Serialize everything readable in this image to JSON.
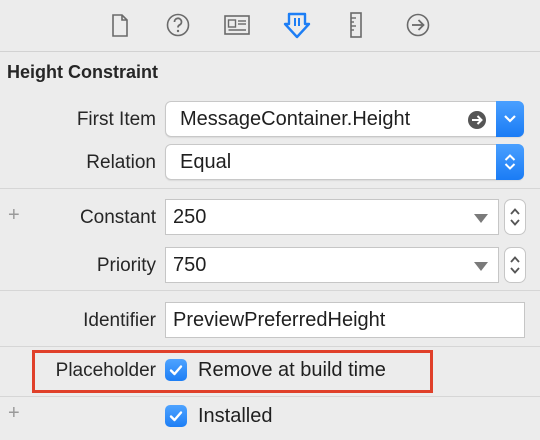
{
  "toolbar": {
    "icons": [
      "file-icon",
      "help-icon",
      "identity-icon",
      "attributes-icon",
      "size-icon",
      "connections-icon"
    ]
  },
  "section": {
    "title": "Height Constraint"
  },
  "first_item": {
    "label": "First Item",
    "value": "MessageContainer.Height"
  },
  "relation": {
    "label": "Relation",
    "value": "Equal"
  },
  "constant": {
    "label": "Constant",
    "value": "250"
  },
  "priority": {
    "label": "Priority",
    "value": "750"
  },
  "identifier": {
    "label": "Identifier",
    "value": "PreviewPreferredHeight"
  },
  "placeholder": {
    "label": "Placeholder",
    "checkbox_label": "Remove at build time",
    "checked": true
  },
  "installed": {
    "label": "Installed",
    "checked": true
  },
  "colors": {
    "accent": "#1d7ef5",
    "highlight": "#e0402a"
  }
}
